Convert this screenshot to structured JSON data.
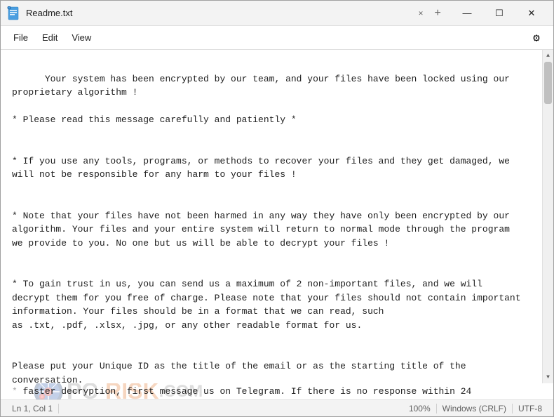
{
  "window": {
    "title": "Readme.txt",
    "icon": "📝"
  },
  "tabs": {
    "close_label": "✕",
    "add_label": "+"
  },
  "title_buttons": {
    "minimize": "—",
    "maximize": "☐",
    "close": "✕"
  },
  "menu": {
    "file": "File",
    "edit": "Edit",
    "view": "View"
  },
  "settings_icon": "⚙",
  "content": {
    "text": "Your system has been encrypted by our team, and your files have been locked using our\nproprietary algorithm !\n\n* Please read this message carefully and patiently *\n\n\n* If you use any tools, programs, or methods to recover your files and they get damaged, we\nwill not be responsible for any harm to your files !\n\n\n* Note that your files have not been harmed in any way they have only been encrypted by our\nalgorithm. Your files and your entire system will return to normal mode through the program\nwe provide to you. No one but us will be able to decrypt your files !\n\n\n* To gain trust in us, you can send us a maximum of 2 non-important files, and we will\ndecrypt them for you free of charge. Please note that your files should not contain important\ninformation. Your files should be in a format that we can read, such\nas .txt, .pdf, .xlsx, .jpg, or any other readable format for us.\n\n\nPlease put your Unique ID as the title of the email or as the starting title of the\nconversation.",
    "last_line": "faster decryption, first message us on Telegram. If there is no response within 24"
  },
  "status_bar": {
    "position": "Ln 1, Col 1",
    "zoom": "100%",
    "line_ending": "Windows (CRLF)",
    "encoding": "UTF-8"
  },
  "watermark": {
    "pc": "PC",
    "separator": "-",
    "risk": "RISK",
    "dot": ".",
    "com": "COM"
  }
}
